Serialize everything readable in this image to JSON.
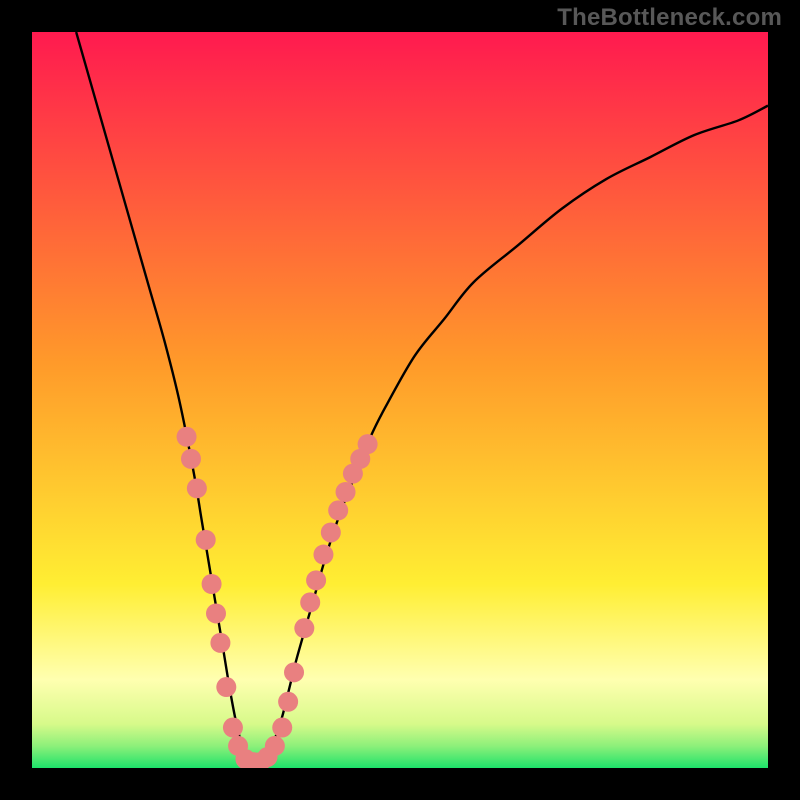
{
  "watermark": "TheBottleneck.com",
  "colors": {
    "bg_black": "#000000",
    "curve": "#000000",
    "dot_fill": "#e98080",
    "grad_top": "#ff1a4f",
    "grad_mid1": "#ff9a2a",
    "grad_mid2": "#ffee33",
    "grad_low": "#ffffb0",
    "grad_bottom": "#1ee26a"
  },
  "chart_data": {
    "type": "line",
    "title": "",
    "xlabel": "",
    "ylabel": "",
    "xlim": [
      0,
      100
    ],
    "ylim": [
      0,
      100
    ],
    "series": [
      {
        "name": "bottleneck-curve",
        "x": [
          6,
          8,
          10,
          12,
          14,
          16,
          18,
          20,
          22,
          23,
          24,
          25,
          26,
          27,
          28,
          29,
          30,
          31,
          32,
          33,
          34,
          35,
          36,
          38,
          40,
          42,
          44,
          46,
          48,
          52,
          56,
          60,
          66,
          72,
          78,
          84,
          90,
          96,
          100
        ],
        "y": [
          100,
          93,
          86,
          79,
          72,
          65,
          58,
          50,
          40,
          34,
          28,
          22,
          16,
          10,
          5,
          2,
          1,
          1,
          2,
          4,
          7,
          11,
          15,
          22,
          29,
          35,
          40,
          45,
          49,
          56,
          61,
          66,
          71,
          76,
          80,
          83,
          86,
          88,
          90
        ]
      }
    ],
    "dots": {
      "name": "highlight-points",
      "points": [
        {
          "x": 21.0,
          "y": 45
        },
        {
          "x": 21.6,
          "y": 42
        },
        {
          "x": 22.4,
          "y": 38
        },
        {
          "x": 23.6,
          "y": 31
        },
        {
          "x": 24.4,
          "y": 25
        },
        {
          "x": 25.0,
          "y": 21
        },
        {
          "x": 25.6,
          "y": 17
        },
        {
          "x": 26.4,
          "y": 11
        },
        {
          "x": 27.3,
          "y": 5.5
        },
        {
          "x": 28.0,
          "y": 3
        },
        {
          "x": 29.0,
          "y": 1.2
        },
        {
          "x": 30.0,
          "y": 0.8
        },
        {
          "x": 31.0,
          "y": 0.8
        },
        {
          "x": 32.0,
          "y": 1.5
        },
        {
          "x": 33.0,
          "y": 3
        },
        {
          "x": 34.0,
          "y": 5.5
        },
        {
          "x": 34.8,
          "y": 9
        },
        {
          "x": 35.6,
          "y": 13
        },
        {
          "x": 37.0,
          "y": 19
        },
        {
          "x": 37.8,
          "y": 22.5
        },
        {
          "x": 38.6,
          "y": 25.5
        },
        {
          "x": 39.6,
          "y": 29
        },
        {
          "x": 40.6,
          "y": 32
        },
        {
          "x": 41.6,
          "y": 35
        },
        {
          "x": 42.6,
          "y": 37.5
        },
        {
          "x": 43.6,
          "y": 40
        },
        {
          "x": 44.6,
          "y": 42
        },
        {
          "x": 45.6,
          "y": 44
        }
      ]
    },
    "gradient_bands": [
      {
        "y": 0,
        "color": "#1ee26a"
      },
      {
        "y": 3,
        "color": "#8df07a"
      },
      {
        "y": 6,
        "color": "#d7fa8a"
      },
      {
        "y": 12,
        "color": "#ffffb0"
      },
      {
        "y": 25,
        "color": "#ffee33"
      },
      {
        "y": 55,
        "color": "#ff9a2a"
      },
      {
        "y": 100,
        "color": "#ff1a4f"
      }
    ]
  }
}
